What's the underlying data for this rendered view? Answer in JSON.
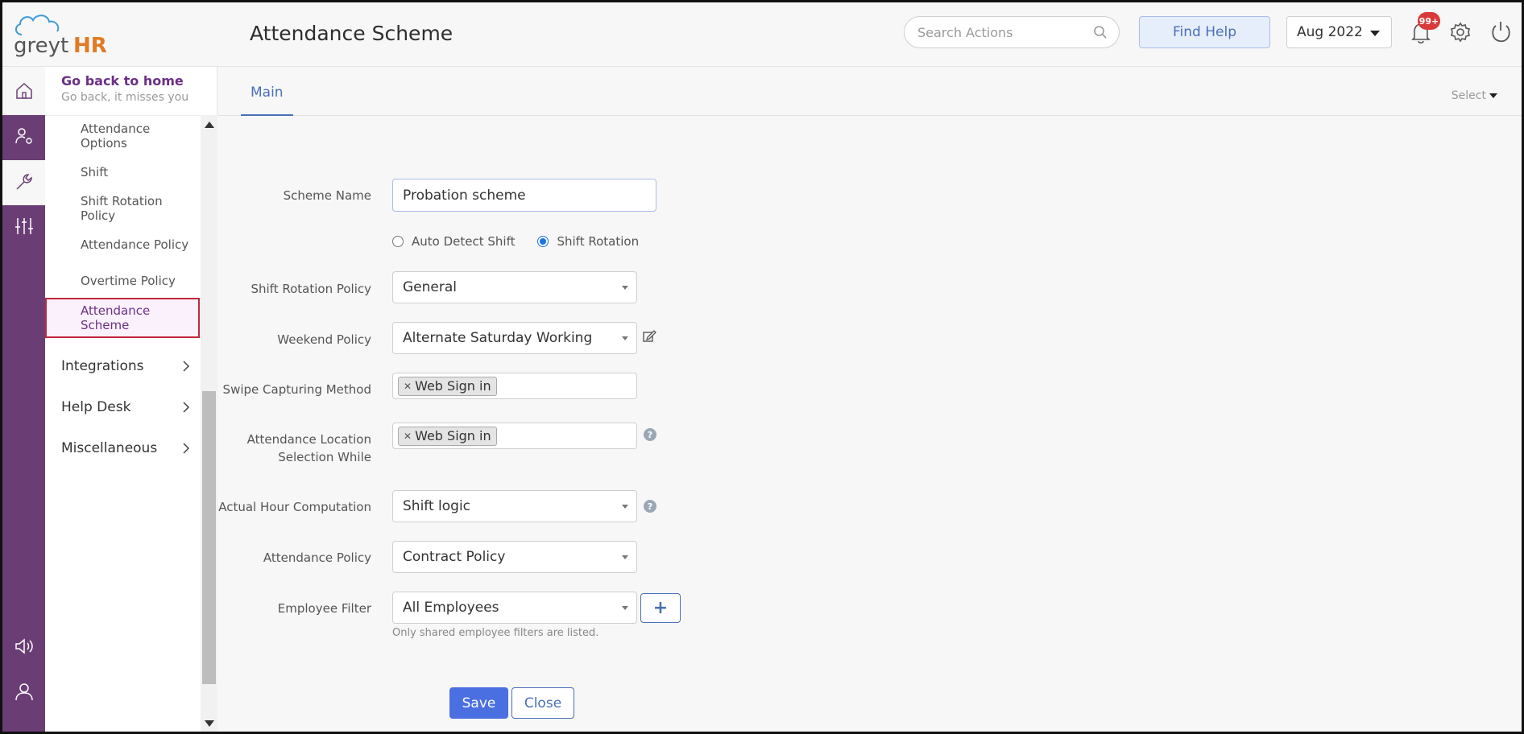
{
  "header": {
    "logo_text_1": "greyt",
    "logo_text_2": "HR",
    "title": "Attendance Scheme",
    "search_placeholder": "Search Actions",
    "find_help_label": "Find Help",
    "month_value": "Aug 2022",
    "notification_badge": "99+"
  },
  "sidebar": {
    "home_title": "Go back to home",
    "home_subtitle": "Go back, it misses you",
    "sub_items": [
      {
        "label": "Attendance Options"
      },
      {
        "label": "Shift"
      },
      {
        "label": "Shift Rotation Policy"
      },
      {
        "label": "Attendance Policy"
      },
      {
        "label": "Overtime Policy"
      },
      {
        "label": "Attendance Scheme",
        "active": true
      }
    ],
    "groups": [
      {
        "label": "Integrations"
      },
      {
        "label": "Help Desk"
      },
      {
        "label": "Miscellaneous"
      }
    ]
  },
  "tabs": {
    "main_label": "Main",
    "select_label": "Select"
  },
  "form": {
    "scheme_name_label": "Scheme Name",
    "scheme_name_value": "Probation scheme",
    "radio_auto_label": "Auto Detect Shift",
    "radio_rotation_label": "Shift Rotation",
    "shift_rotation_policy_label": "Shift Rotation Policy",
    "shift_rotation_policy_value": "General",
    "weekend_policy_label": "Weekend Policy",
    "weekend_policy_value": "Alternate Saturday Working",
    "swipe_method_label": "Swipe Capturing Method",
    "swipe_method_tag": "Web Sign in",
    "location_label_1": "Attendance Location",
    "location_label_2": "Selection While",
    "location_tag": "Web Sign in",
    "actual_hour_label": "Actual Hour Computation",
    "actual_hour_value": "Shift logic",
    "attendance_policy_label": "Attendance Policy",
    "attendance_policy_value": "Contract Policy",
    "employee_filter_label": "Employee Filter",
    "employee_filter_value": "All Employees",
    "employee_filter_hint": "Only shared employee filters are listed.",
    "save_label": "Save",
    "close_label": "Close"
  },
  "colors": {
    "rail": "#6a3e75",
    "accent": "#4a6fe0",
    "active_border": "#c0283a",
    "logo_orange": "#e07b24"
  }
}
